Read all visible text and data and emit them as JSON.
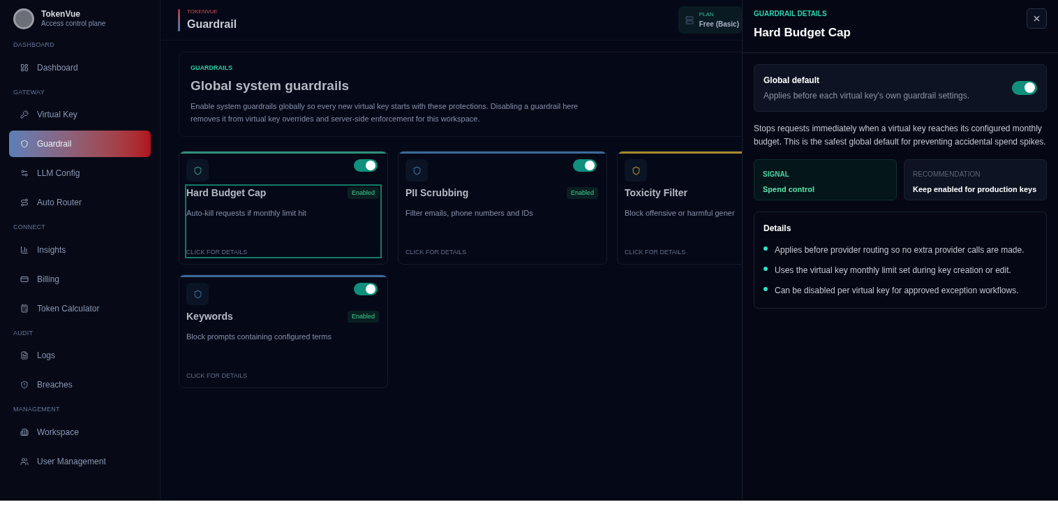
{
  "sidebar": {
    "brand": {
      "name": "TokenVue",
      "subtitle": "Access control plane"
    },
    "sections": [
      {
        "label": "DASHBOARD",
        "items": [
          {
            "label": "Dashboard",
            "selected": false
          }
        ]
      },
      {
        "label": "GATEWAY",
        "items": [
          {
            "label": "Virtual Key",
            "selected": false
          },
          {
            "label": "Guardrail",
            "selected": true
          },
          {
            "label": "LLM Config",
            "selected": false
          },
          {
            "label": "Auto Router",
            "selected": false
          }
        ]
      },
      {
        "label": "CONNECT",
        "items": [
          {
            "label": "Insights",
            "selected": false
          },
          {
            "label": "Billing",
            "selected": false
          },
          {
            "label": "Token Calculator",
            "selected": false
          }
        ]
      },
      {
        "label": "AUDIT",
        "items": [
          {
            "label": "Logs",
            "selected": false
          },
          {
            "label": "Breaches",
            "selected": false
          }
        ]
      },
      {
        "label": "MANAGEMENT",
        "items": [
          {
            "label": "Workspace",
            "selected": false
          },
          {
            "label": "User Management",
            "selected": false
          }
        ]
      }
    ]
  },
  "header": {
    "eyebrow": "TOKENVUE",
    "title": "Guardrail",
    "plan": {
      "label": "PLAN",
      "value": "Free (Basic)"
    }
  },
  "intro": {
    "eyebrow": "GUARDRAILS",
    "title": "Global system guardrails",
    "description": "Enable system guardrails globally so every new virtual key starts with these protections. Disabling a guardrail here removes it from virtual key overrides and server-side enforcement for this workspace."
  },
  "cards": [
    {
      "title": "Hard Budget Cap",
      "badge": "Enabled",
      "description": "Auto-kill requests if monthly limit hit",
      "link": "CLICK FOR DETAILS",
      "on": true,
      "selected": true,
      "color": "#2f8f7a"
    },
    {
      "title": "PII Scrubbing",
      "badge": "Enabled",
      "description": "Filter emails, phone numbers and IDs",
      "link": "CLICK FOR DETAILS",
      "on": true,
      "selected": false,
      "color": "#3a6a9a"
    },
    {
      "title": "Toxicity Filter",
      "description": "Block offensive or harmful gener",
      "link": "CLICK FOR DETAILS",
      "selected": false,
      "color": "#a88a2a"
    },
    {
      "title": "Keywords",
      "badge": "Enabled",
      "description": "Block prompts containing configured terms",
      "link": "CLICK FOR DETAILS",
      "on": true,
      "selected": false,
      "color": "#3a6a9a"
    }
  ],
  "drawer": {
    "eyebrow": "GUARDRAIL DETAILS",
    "title": "Hard Budget Cap",
    "global_default": {
      "title": "Global default",
      "description": "Applies before each virtual key's own guardrail settings.",
      "on": true
    },
    "summary": "Stops requests immediately when a virtual key reaches its configured monthly budget. This is the safest global default for preventing accidental spend spikes.",
    "stats": [
      {
        "kind": "signal",
        "label": "SIGNAL",
        "value": "Spend control"
      },
      {
        "kind": "plain",
        "label": "RECOMMENDATION",
        "value": "Keep enabled for production keys"
      }
    ],
    "details": {
      "title": "Details",
      "items": [
        "Applies before provider routing so no extra provider calls are made.",
        "Uses the virtual key monthly limit set during key creation or edit.",
        "Can be disabled per virtual key for approved exception workflows."
      ]
    }
  }
}
